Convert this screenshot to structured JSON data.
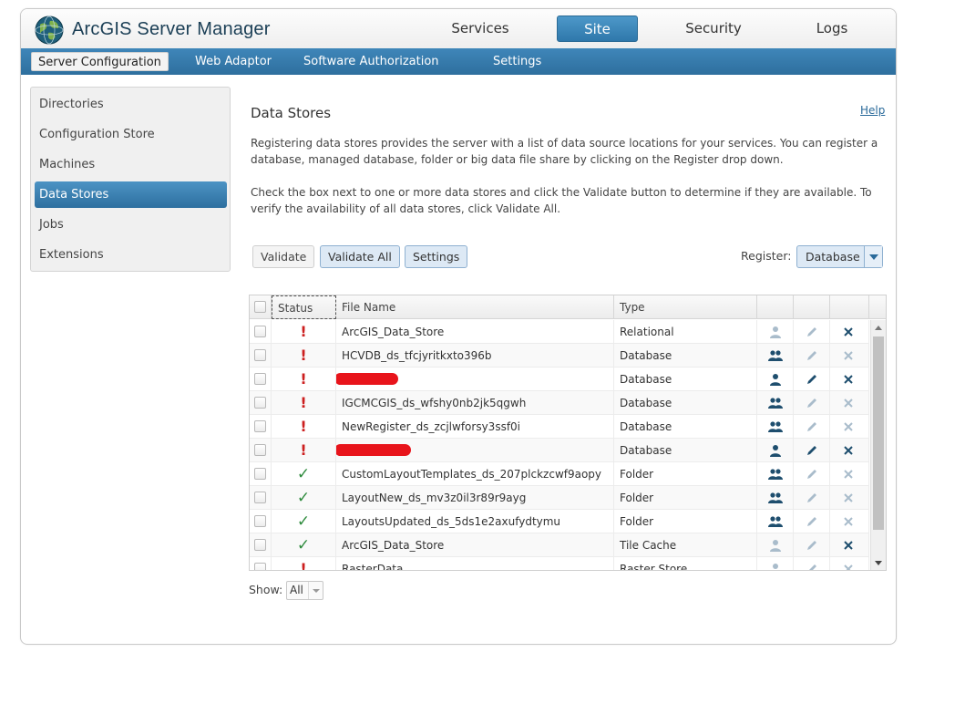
{
  "app": {
    "title": "ArcGIS Server Manager"
  },
  "top_nav": [
    {
      "label": "Services",
      "active": false
    },
    {
      "label": "Site",
      "active": true
    },
    {
      "label": "Security",
      "active": false
    },
    {
      "label": "Logs",
      "active": false
    }
  ],
  "sub_nav": [
    {
      "label": "Server Configuration",
      "active": true
    },
    {
      "label": "Web Adaptor",
      "active": false
    },
    {
      "label": "Software Authorization",
      "active": false
    },
    {
      "label": "Settings",
      "active": false
    }
  ],
  "sidebar": {
    "items": [
      {
        "label": "Directories",
        "active": false
      },
      {
        "label": "Configuration Store",
        "active": false
      },
      {
        "label": "Machines",
        "active": false
      },
      {
        "label": "Data Stores",
        "active": true
      },
      {
        "label": "Jobs",
        "active": false
      },
      {
        "label": "Extensions",
        "active": false
      }
    ]
  },
  "main": {
    "title": "Data Stores",
    "help_label": "Help",
    "description_1": "Registering data stores provides the server with a list of data source locations for your services. You can register a database, managed database, folder or big data file share by clicking on the Register drop down.",
    "description_2": "Check the box next to one or more data stores and click the Validate button to determine if they are available. To verify the availability of all data stores, click Validate All.",
    "buttons": {
      "validate": "Validate",
      "validate_all": "Validate All",
      "settings": "Settings"
    },
    "register": {
      "label": "Register:",
      "value": "Database"
    },
    "table": {
      "columns": [
        "Status",
        "File Name",
        "Type"
      ],
      "rows": [
        {
          "status": "error",
          "name": "ArcGIS_Data_Store",
          "type": "Relational",
          "icons_active": false
        },
        {
          "status": "error",
          "name": "HCVDB_ds_tfcjyritkxto396b",
          "type": "Database",
          "icons_active": false
        },
        {
          "status": "error",
          "name": "",
          "type": "Database",
          "icons_active": true,
          "redacted": true
        },
        {
          "status": "error",
          "name": "IGCMCGIS_ds_wfshy0nb2jk5qgwh",
          "type": "Database",
          "icons_active": false
        },
        {
          "status": "error",
          "name": "NewRegister_ds_zcjlwforsy3ssf0i",
          "type": "Database",
          "icons_active": false
        },
        {
          "status": "error",
          "name": "",
          "type": "Database",
          "icons_active": true,
          "redacted": true
        },
        {
          "status": "ok",
          "name": "CustomLayoutTemplates_ds_207plckzcwf9aopy",
          "type": "Folder",
          "icons_active": false
        },
        {
          "status": "ok",
          "name": "LayoutNew_ds_mv3z0il3r89r9ayg",
          "type": "Folder",
          "icons_active": false
        },
        {
          "status": "ok",
          "name": "LayoutsUpdated_ds_5ds1e2axufydtymu",
          "type": "Folder",
          "icons_active": false
        },
        {
          "status": "ok",
          "name": "ArcGIS_Data_Store",
          "type": "Tile Cache",
          "icons_active": false,
          "delete_active": true
        },
        {
          "status": "error",
          "name": "RasterData",
          "type": "Raster Store",
          "icons_active": false,
          "partial": true
        }
      ]
    },
    "show": {
      "label": "Show:",
      "value": "All"
    }
  },
  "colors": {
    "accent_blue": "#2e6f9e",
    "error_red": "#cc1f1f",
    "ok_green": "#2e8b3d",
    "icon_active": "#1e4e6e",
    "icon_inactive": "#a9bccb"
  }
}
